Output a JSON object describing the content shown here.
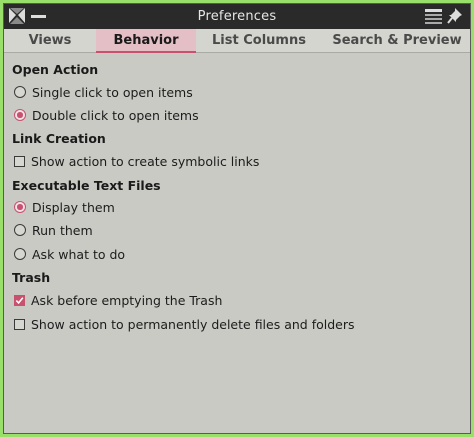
{
  "window": {
    "title": "Preferences"
  },
  "titlebar": {
    "icons": [
      "close-icon",
      "minimize-icon",
      "menu-icon",
      "pin-icon"
    ]
  },
  "tabs": [
    {
      "label": "Views",
      "active": false
    },
    {
      "label": "Behavior",
      "active": true
    },
    {
      "label": "List Columns",
      "active": false
    },
    {
      "label": "Search & Preview",
      "active": false
    }
  ],
  "sections": {
    "open_action": {
      "title": "Open Action",
      "options": [
        {
          "label": "Single click to open items",
          "selected": false
        },
        {
          "label": "Double click to open items",
          "selected": true
        }
      ]
    },
    "link_creation": {
      "title": "Link Creation",
      "options": [
        {
          "label": "Show action to create symbolic links",
          "checked": false
        }
      ]
    },
    "executable": {
      "title": "Executable Text Files",
      "options": [
        {
          "label": "Display them",
          "selected": true
        },
        {
          "label": "Run them",
          "selected": false
        },
        {
          "label": "Ask what to do",
          "selected": false
        }
      ]
    },
    "trash": {
      "title": "Trash",
      "options": [
        {
          "label": "Ask before emptying the Trash",
          "checked": true
        },
        {
          "label": "Show action to permanently delete files and folders",
          "checked": false
        }
      ]
    }
  },
  "colors": {
    "accent": "#c8516e",
    "background": "#c9cac4",
    "titlebar": "#2a2a2a",
    "frame": "#98e06a"
  }
}
